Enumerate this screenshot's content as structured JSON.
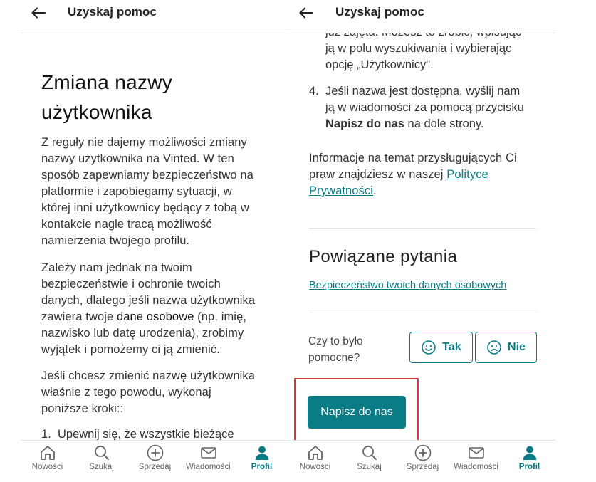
{
  "header": {
    "title": "Uzyskaj pomoc"
  },
  "article": {
    "title_line1": "Zmiana nazwy",
    "title_line2": "użytkownika",
    "p1_lines": [
      "Z reguły nie dajemy możliwości zmiany",
      "nazwy użytkownika na Vinted. W ten",
      "sposób zapewniamy bezpieczeństwo na",
      "platformie i zapobiegamy sytuacji, w",
      "której inni użytkownicy będący z tobą w",
      "kontakcie nagle tracą możliwość",
      "namierzenia twojego profilu."
    ],
    "p2_line1": "Zależy nam jednak na twoim",
    "p2_line2": "bezpieczeństwie i ochronie twoich",
    "p2_line3": "danych, dlatego jeśli nazwa użytkownika",
    "p2_line4_pre": "zawiera twoje ",
    "p2_line4_bold": "dane osobowe",
    "p2_line4_post": " (np. imię,",
    "p2_line5": "nazwisko lub datę urodzenia), zrobimy",
    "p2_line6": "wyjątek i pomożemy ci ją zmienić.",
    "p3_lines": [
      "Jeśli chcesz zmienić nazwę użytkownika",
      "właśnie z tego powodu, wykonaj",
      "poniższe kroki::"
    ],
    "step1_num": "1.",
    "step1_text": "Upewnij się, że wszystkie bieżące",
    "step3_partial_line0": "już zajęta. Możesz to zrobić, wpisując",
    "step3_partial_line1": "ją w polu wyszukiwania i wybierając",
    "step3_partial_line2": "opcję „Użytkownicy\".",
    "step4_num": "4.",
    "step4_line1": "Jeśli nazwa jest dostępna, wyślij nam",
    "step4_line2": "ją w wiadomości za pomocą przycisku",
    "step4_bold": "Napisz do nas",
    "step4_line3_post": " na dole strony.",
    "info_line1": "Informacje na temat przysługujących Ci",
    "info_line2_pre": "praw znajdziesz w naszej ",
    "info_link_part1": "Polityce",
    "info_link_part2": "Prywatności",
    "info_line3_post": "."
  },
  "related": {
    "title": "Powiązane pytania",
    "link": "Bezpieczeństwo twoich danych osobowych"
  },
  "feedback": {
    "question_line1": "Czy to było",
    "question_line2": "pomocne?",
    "yes": "Tak",
    "no": "Nie"
  },
  "contact_button": "Napisz do nas",
  "nav": {
    "items": [
      {
        "label": "Nowości",
        "icon": "home-icon"
      },
      {
        "label": "Szukaj",
        "icon": "search-icon"
      },
      {
        "label": "Sprzedaj",
        "icon": "plus-circle-icon"
      },
      {
        "label": "Wiadomości",
        "icon": "mail-icon"
      },
      {
        "label": "Profil",
        "icon": "person-icon"
      }
    ],
    "active": "Profil"
  },
  "colors": {
    "accent": "#0a7c86",
    "highlight": "#d0393f",
    "text": "#333333"
  }
}
